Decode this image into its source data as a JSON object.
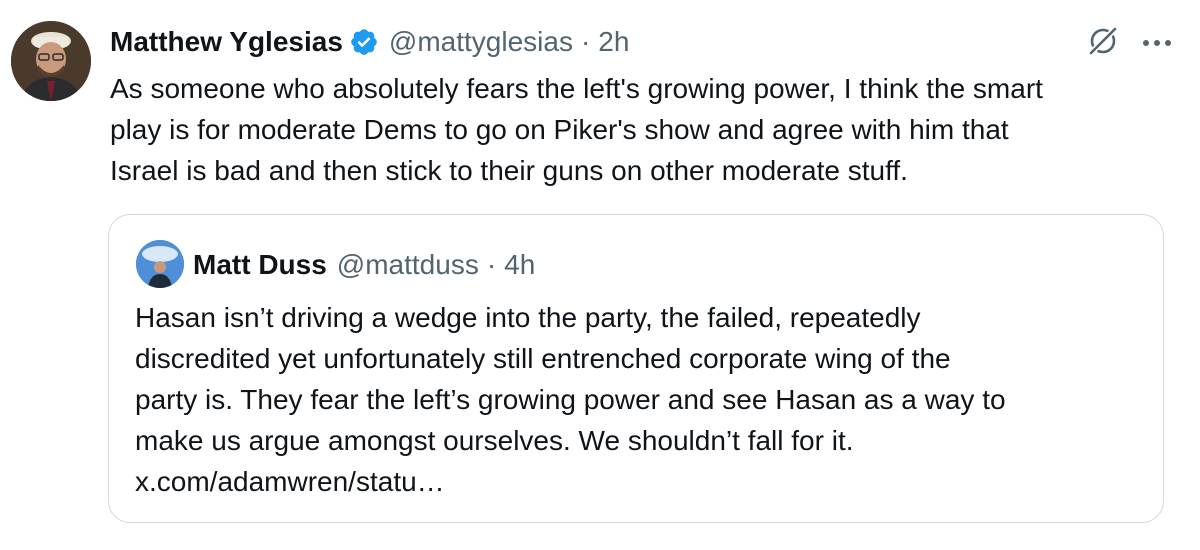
{
  "tweet": {
    "author_name": "Matthew Yglesias",
    "handle": "@mattyglesias",
    "separator": "·",
    "time": "2h",
    "text": "As someone who absolutely fears the left's growing power, I think the smart\nplay is for moderate Dems to go on Piker's show and agree with him that\nIsrael is bad and then stick to their guns on other moderate stuff."
  },
  "quoted": {
    "author_name": "Matt Duss",
    "handle": "@mattduss",
    "separator": "·",
    "time": "4h",
    "text": "Hasan isn’t driving a wedge into the party, the failed, repeatedly\ndiscredited yet unfortunately still entrenched corporate wing of the\nparty is. They fear the left’s growing power and see Hasan as a way to\nmake us argue amongst ourselves. We shouldn’t fall for it.\nx.com/adamwren/statu…"
  },
  "icons": {
    "verified": "verified-badge-icon",
    "grok": "grok-icon",
    "more": "more-icon"
  },
  "colors": {
    "text": "#0f1419",
    "secondary": "#536471",
    "verified": "#1d9bf0",
    "border": "#cfd9de"
  }
}
